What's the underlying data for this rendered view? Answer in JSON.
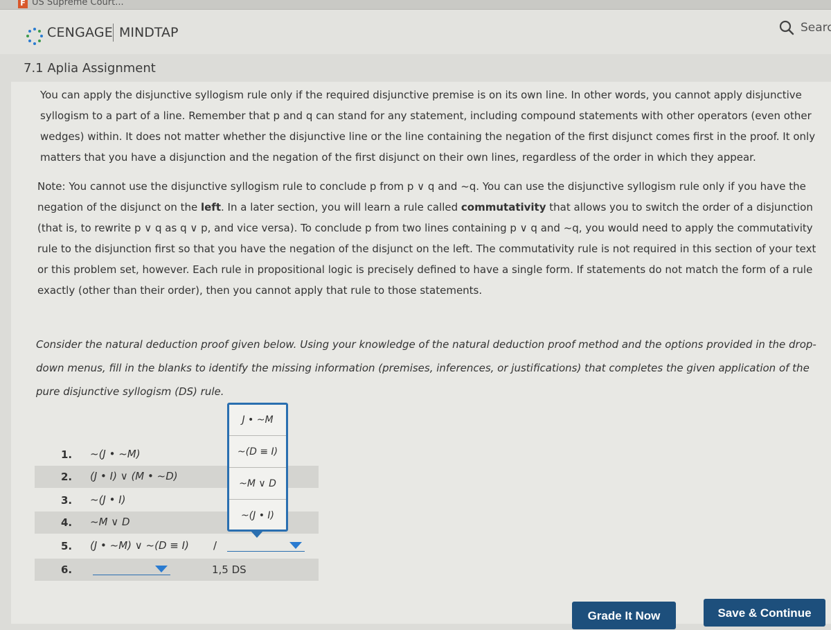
{
  "browser": {
    "tab_favicon": "F",
    "tab_title": "US Supreme Court..."
  },
  "header": {
    "brand": "CENGAGE",
    "product": "MINDTAP",
    "search_label": "Searc"
  },
  "assignment": {
    "title": "7.1 Aplia Assignment"
  },
  "paragraphs": {
    "intro": "You can apply the disjunctive syllogism rule only if the required disjunctive premise is on its own line. In other words, you cannot apply disjunctive syllogism to a part of a line. Remember that p and q can stand for any statement, including compound statements with other operators (even other wedges) within. It does not matter whether the disjunctive line or the line containing the negation of the first disjunct comes first in the proof. It only matters that you have a disjunction and the negation of the first disjunct on their own lines, regardless of the order in which they appear.",
    "note_a": "Note: You cannot use the disjunctive syllogism rule to conclude p from p ∨ q and ~q. You can use the disjunctive syllogism rule only if you have the negation of the disjunct on the ",
    "note_left": "left",
    "note_b": ". In a later section, you will learn a rule called ",
    "note_commutativity": "commutativity",
    "note_c": " that allows you to switch the order of a disjunction (that is, to rewrite p ∨ q as q ∨ p, and vice versa). To conclude p from two lines containing p ∨ q and ~q, you would need to apply the commutativity rule to the disjunction first so that you have the negation of the disjunct on the left. The commutativity rule is not required in this section of your text or this problem set, however. Each rule in propositional logic is precisely defined to have a single form. If statements do not match the form of a rule exactly (other than their order), then you cannot apply that rule to those statements.",
    "instructions": "Consider the natural deduction proof given below. Using your knowledge of the natural deduction proof method and the options provided in the drop-down menus, fill in the blanks to identify the missing information (premises, inferences, or justifications) that completes the given application of the pure disjunctive syllogism (DS) rule."
  },
  "proof": {
    "lines": [
      {
        "num": "1.",
        "stmt": "~(J • ~M)"
      },
      {
        "num": "2.",
        "stmt": "(J • I) ∨ (M • ~D)"
      },
      {
        "num": "3.",
        "stmt": "~(J • I)"
      },
      {
        "num": "4.",
        "stmt": "~M ∨ D"
      },
      {
        "num": "5.",
        "stmt": "(J • ~M) ∨ ~(D ≡ I)",
        "slash": "/"
      },
      {
        "num": "6.",
        "stmt": ""
      }
    ],
    "line6_justification": "1,5 DS"
  },
  "dropdown": {
    "open": true,
    "options": [
      "J • ~M",
      "~(D ≡ I)",
      "~M ∨ D",
      "~(J • I)"
    ]
  },
  "buttons": {
    "grade": "Grade It Now",
    "save": "Save & Continue"
  },
  "colors": {
    "accent": "#2a6fb0",
    "button": "#1d4f7c",
    "favicon": "#d9582b"
  }
}
